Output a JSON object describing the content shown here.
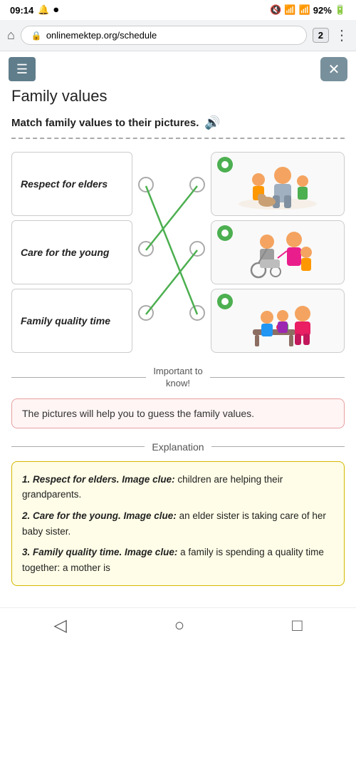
{
  "status_bar": {
    "time": "09:14",
    "battery": "92%"
  },
  "browser": {
    "url": "onlinemektep.org/schedule",
    "tab_count": "2"
  },
  "toolbar": {
    "hamburger_label": "☰",
    "close_label": "✕"
  },
  "page": {
    "title": "Family values",
    "instruction": "Match family values to their pictures.",
    "important_label": "Important to\nknow!",
    "hint_text": "The pictures will help you to guess the family values.",
    "explanation_label": "Explanation"
  },
  "match_items": [
    {
      "id": "1",
      "label": "Respect for elders"
    },
    {
      "id": "2",
      "label": "Care for the young"
    },
    {
      "id": "3",
      "label": "Family quality time"
    }
  ],
  "explanation": {
    "item1_bold": "1. Respect for elders. Image clue:",
    "item1_text": " children are helping their grandparents.",
    "item2_bold": "2. Care for the young. Image clue:",
    "item2_text": " an elder sister is taking care of her baby sister.",
    "item3_bold": "3. Family quality time. Image clue:",
    "item3_text": " a family is spending a quality time together: a mother is"
  },
  "nav": {
    "back": "◁",
    "home": "○",
    "recent": "□"
  }
}
